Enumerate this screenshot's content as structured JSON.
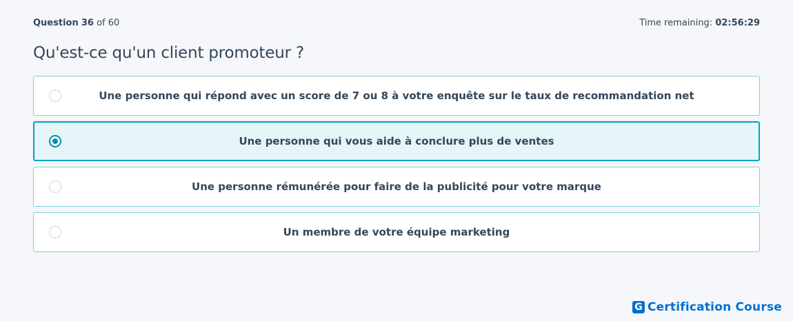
{
  "header": {
    "question_label": "Question",
    "question_number": "36",
    "question_of": "of 60",
    "timer_label": "Time remaining:",
    "timer_value": "02:56:29"
  },
  "question": {
    "text": "Qu'est-ce qu'un client promoteur ?"
  },
  "options": [
    {
      "label": "Une personne qui répond avec un score de 7 ou 8 à votre enquête sur le taux de recommandation net",
      "selected": false
    },
    {
      "label": "Une personne qui vous aide à conclure plus de ventes",
      "selected": true
    },
    {
      "label": "Une personne rémunérée pour faire de la publicité pour votre marque",
      "selected": false
    },
    {
      "label": "Un membre de votre équipe marketing",
      "selected": false
    }
  ],
  "brand": {
    "icon_letter": "G",
    "name": "Certification Course"
  },
  "colors": {
    "accent": "#00a4bd",
    "brand": "#0070d2",
    "text": "#33475b"
  }
}
